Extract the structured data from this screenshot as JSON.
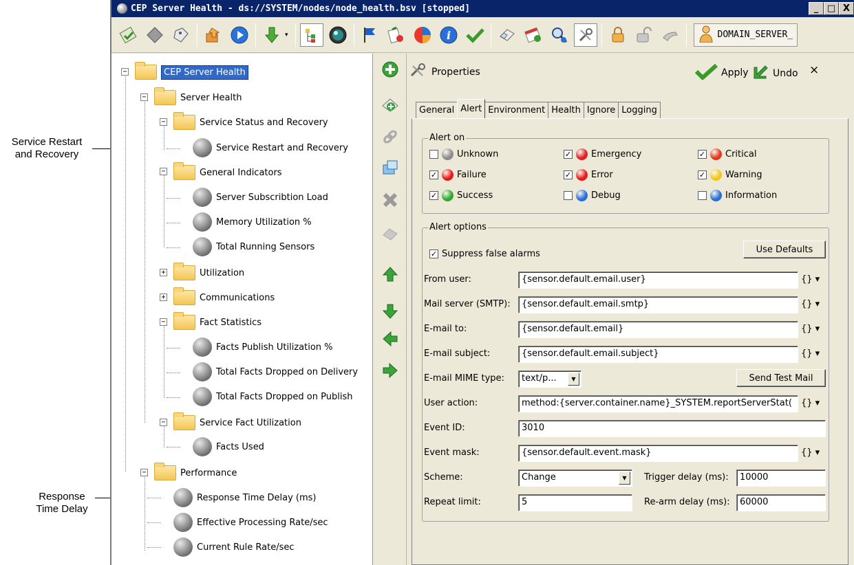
{
  "window": {
    "title": "CEP Server Health - ds://SYSTEM/nodes/node_health.bsv [stopped]",
    "controls": [
      "_",
      "□",
      "X"
    ]
  },
  "toolbar": {
    "icons": [
      "check-document-icon",
      "diamond-icon",
      "tag-icon",
      "export-icon",
      "play-icon",
      "download-icon",
      "tree-view-icon",
      "gauge-icon",
      "flag-icon",
      "certificate-icon",
      "chart-icon",
      "info-icon",
      "checkmark-icon",
      "eraser-icon",
      "calendar-icon",
      "search-icon",
      "wrench-icon",
      "lock-icon",
      "unlock-icon",
      "hand-icon"
    ],
    "domain_label": "DOMAIN_SERVER_"
  },
  "callouts": {
    "service_restart": [
      "Service Restart",
      "and Recovery"
    ],
    "response_time": [
      "Response",
      "Time Delay"
    ]
  },
  "tree": {
    "root": "CEP Server Health",
    "server_health": "Server Health",
    "service_status": "Service Status and Recovery",
    "service_restart": "Service Restart and Recovery",
    "general_indicators": "General Indicators",
    "subscription_load": "Server Subscribtion Load",
    "memory_util": "Memory Utilization %",
    "total_sensors": "Total Running Sensors",
    "utilization": "Utilization",
    "communications": "Communications",
    "fact_statistics": "Fact Statistics",
    "facts_publish": "Facts Publish Utilization %",
    "dropped_delivery": "Total Facts Dropped on Delivery",
    "dropped_publish": "Total Facts Dropped on Publish",
    "service_fact_util": "Service Fact Utilization",
    "facts_used": "Facts Used",
    "performance": "Performance",
    "response_time": "Response Time Delay (ms)",
    "processing_rate": "Effective Processing Rate/sec",
    "rule_rate": "Current Rule Rate/sec",
    "expander_expanded": "−",
    "expander_collapsed": "+"
  },
  "properties": {
    "title": "Properties",
    "apply": "Apply",
    "undo": "Undo",
    "close": "×"
  },
  "tabs": [
    "General",
    "Alert",
    "Environment",
    "Health",
    "Ignore",
    "Logging"
  ],
  "alert_on": {
    "title": "Alert on",
    "check_mark": "✓",
    "items": [
      {
        "label": "Unknown",
        "checked": false,
        "color": "#8c8c8c"
      },
      {
        "label": "Emergency",
        "checked": true,
        "color": "#d22"
      },
      {
        "label": "Critical",
        "checked": true,
        "color": "#e03a1e"
      },
      {
        "label": "Failure",
        "checked": true,
        "color": "#e41b1b"
      },
      {
        "label": "Error",
        "checked": true,
        "color": "#e41b1b"
      },
      {
        "label": "Warning",
        "checked": true,
        "color": "#f3c51b"
      },
      {
        "label": "Success",
        "checked": true,
        "color": "#34a832"
      },
      {
        "label": "Debug",
        "checked": false,
        "color": "#2a6fd6"
      },
      {
        "label": "Information",
        "checked": false,
        "color": "#2a6fd6"
      }
    ]
  },
  "alert_options": {
    "title": "Alert options",
    "suppress": "Suppress false alarms",
    "use_defaults": "Use Defaults",
    "brace_label": "{} ▾",
    "fields": {
      "from_user": {
        "label": "From user:",
        "value": "{sensor.default.email.user}"
      },
      "mail_server": {
        "label": "Mail server (SMTP):",
        "value": "{sensor.default.email.smtp}"
      },
      "email_to": {
        "label": "E-mail to:",
        "value": "{sensor.default.email}"
      },
      "email_subject": {
        "label": "E-mail subject:",
        "value": "{sensor.default.email.subject}"
      },
      "mime_type": {
        "label": "E-mail MIME type:",
        "value": "text/p..."
      },
      "user_action": {
        "label": "User action:",
        "value": "method:{server.container.name}_SYSTEM.reportServerStat("
      },
      "event_id": {
        "label": "Event ID:",
        "value": "3010"
      },
      "event_mask": {
        "label": "Event mask:",
        "value": "{sensor.default.event.mask}"
      },
      "scheme": {
        "label": "Scheme:",
        "value": "Change"
      },
      "trigger_delay": {
        "label": "Trigger delay (ms):",
        "value": "10000"
      },
      "repeat_limit": {
        "label": "Repeat limit:",
        "value": "5"
      },
      "rearm_delay": {
        "label": "Re-arm delay (ms):",
        "value": "60000"
      }
    },
    "send_test_mail": "Send Test Mail"
  }
}
